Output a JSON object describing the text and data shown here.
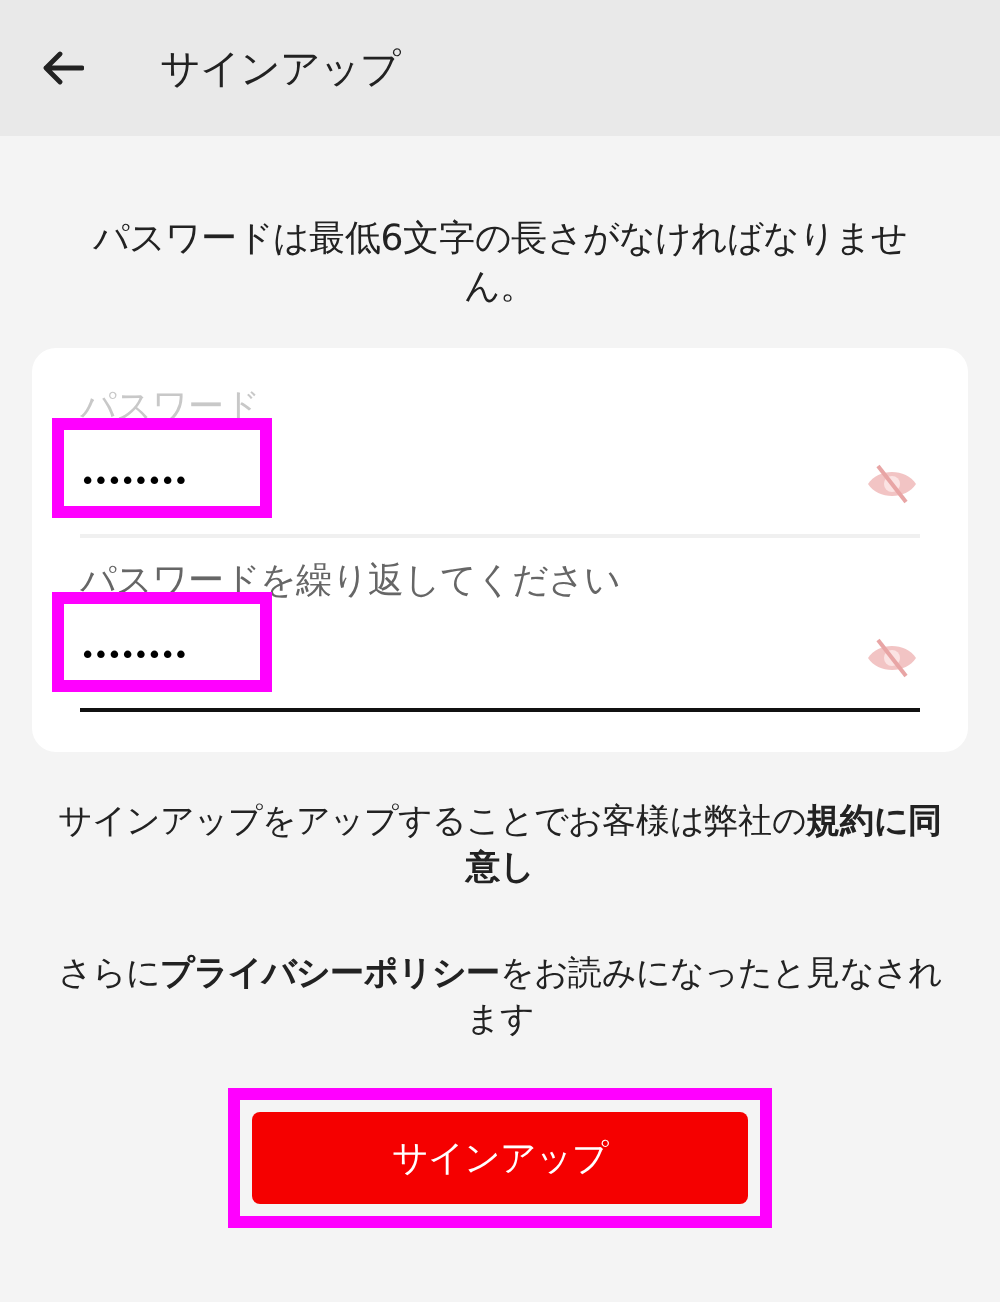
{
  "header": {
    "title": "サインアップ"
  },
  "notice": "パスワードは最低6文字の長さがなければなりません。",
  "fields": [
    {
      "label": "パスワード",
      "value": "••••••••",
      "focused": false,
      "highlighted": true
    },
    {
      "label": "パスワードを繰り返してください",
      "value": "••••••••",
      "focused": true,
      "highlighted": true
    }
  ],
  "terms": [
    "サインアップをアップすることでお客様は弊社の**規約に同意し**",
    "さらに**プライバシーポリシー**をお読みになったと見なされます"
  ],
  "signup_button": {
    "label": "サインアップ",
    "highlighted": true
  }
}
